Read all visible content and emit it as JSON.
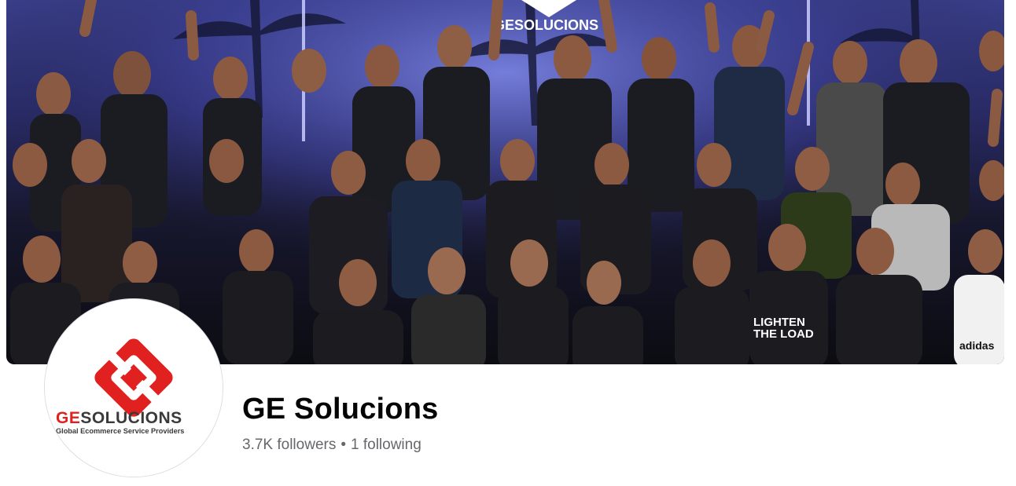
{
  "page": {
    "name": "GE Solucions",
    "followers_label": "3.7K followers",
    "separator": "•",
    "following_label": "1 following"
  },
  "cover_photo": {
    "banner_logo_text": "GESOLUCIONS",
    "shirt_text_line1": "LIGHTEN",
    "shirt_text_line2": "THE LOAD",
    "shirt_brand_text": "adidas"
  },
  "profile_logo": {
    "brand_prefix": "GE",
    "brand_suffix": "SOLUCIONS",
    "tagline": "Global Ecommerce Service Providers",
    "brand_red": "#e1211f",
    "brand_dark": "#3a3a3a"
  }
}
